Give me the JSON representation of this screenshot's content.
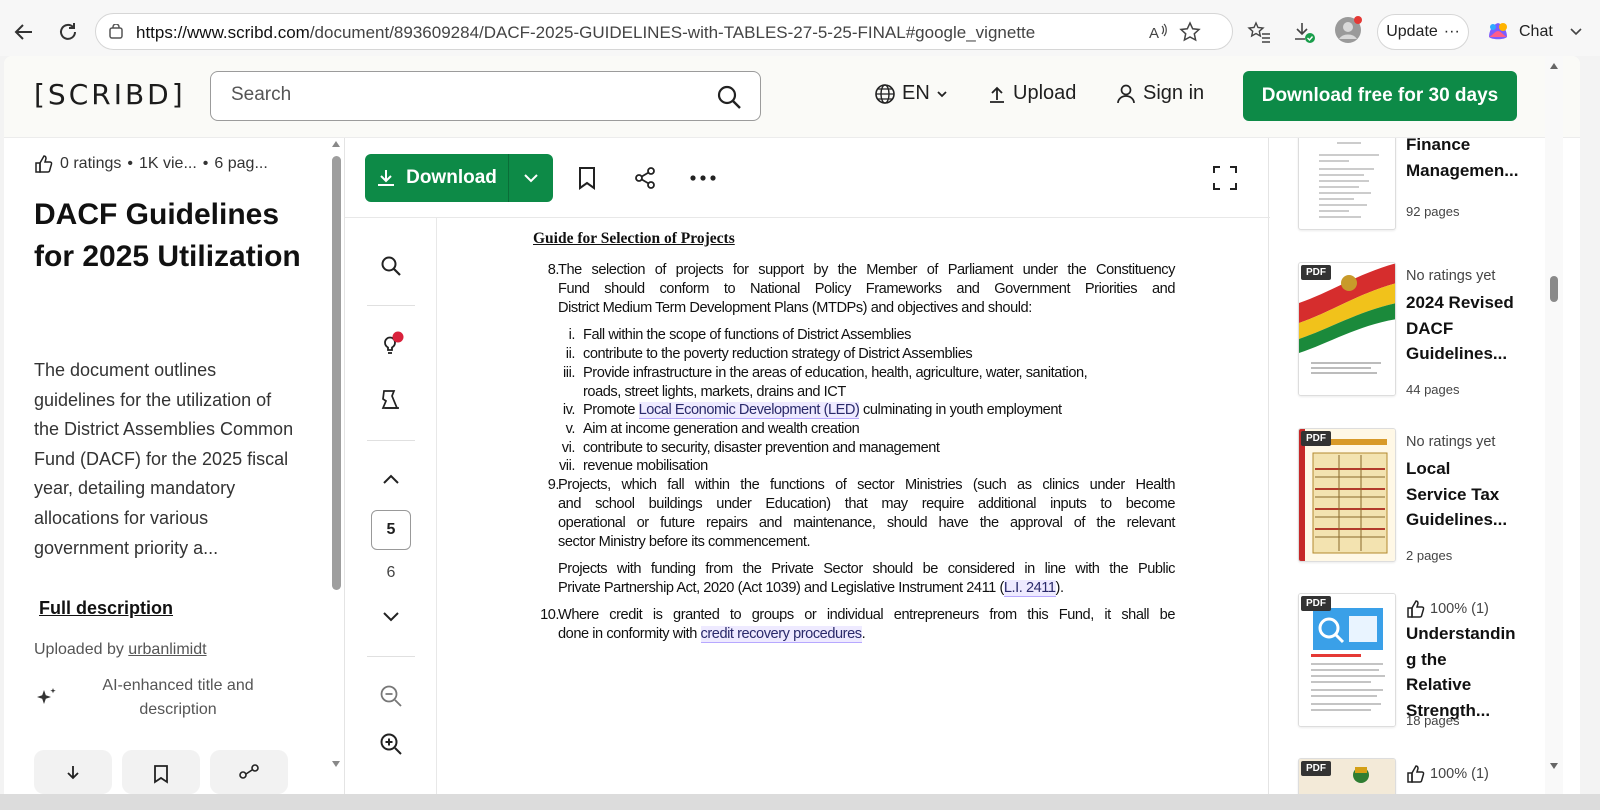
{
  "browser": {
    "url": "https://www.scribd.com/document/893609284/DACF-2025-GUIDELINES-with-TABLES-27-5-25-FINAL#google_vignette",
    "url_host": "https://www.scribd.com",
    "url_path": "/document/893609284/DACF-2025-GUIDELINES-with-TABLES-27-5-25-FINAL#google_vignette",
    "update_label": "Update",
    "update_more": "···",
    "chat_label": "Chat"
  },
  "header": {
    "logo": "[SCRIBD]",
    "search_placeholder": "Search",
    "language": "EN",
    "upload": "Upload",
    "sign_in": "Sign in",
    "cta": "Download free for 30 days",
    "brand_color": "#0d8a47"
  },
  "document": {
    "ratings": "0 ratings",
    "views": "1K vie...",
    "pages": "6 pag...",
    "title": "DACF Guidelines for 2025 Utilization",
    "description": "The document outlines guidelines for the utilization of the District Assemblies Common Fund (DACF) for the 2025 fiscal year, detailing mandatory allocations for various government priority a...",
    "full_description": "Full description",
    "uploaded_prefix": "Uploaded by",
    "uploader": "urbanlimidt",
    "ai_note": "AI-enhanced title and description"
  },
  "viewer": {
    "download": "Download",
    "current_page": "5",
    "next_page": "6"
  },
  "page_content": {
    "heading": "Guide for Selection of Projects",
    "item8_num": "8.",
    "item8_lines": [
      "The selection of projects for support by the Member of Parliament under the Constituency",
      "Fund should conform to National Policy Frameworks and Government Priorities and",
      "District Medium Term Development Plans (MTDPs) and objectives and should:"
    ],
    "roman": [
      {
        "n": "i.",
        "t": "Fall within the scope of functions of District Assemblies"
      },
      {
        "n": "ii.",
        "t": "contribute to the poverty reduction strategy of District Assemblies"
      },
      {
        "n": "iii.",
        "t": "Provide infrastructure in the areas of education, health, agriculture, water, sanitation,"
      },
      {
        "n": "",
        "t": "roads, street lights, markets, drains and ICT"
      },
      {
        "n": "iv.",
        "t": ""
      },
      {
        "n": "v.",
        "t": "Aim at income generation and wealth creation"
      },
      {
        "n": "vi.",
        "t": "contribute to security, disaster prevention and management"
      },
      {
        "n": "vii.",
        "t": "revenue mobilisation"
      }
    ],
    "iv_pre": "Promote ",
    "iv_link": "Local Economic Development (LED)",
    "iv_post": " culminating in youth employment",
    "item9_num": "9.",
    "item9_lines": [
      "Projects, which fall within the functions of sector Ministries (such as clinics under Health",
      "and school buildings under Education) that may require additional inputs to become",
      "operational or future repairs and maintenance, should have the approval of the relevant",
      "sector Ministry before its commencement."
    ],
    "pp_line1": "Projects with funding from the Private Sector should be considered in line with the Public",
    "pp_line2_pre": "Private Partnership Act, 2020 (Act 1039) and Legislative Instrument 2411 (",
    "pp_link": "L.I. 2411",
    "pp_line2_post": ").",
    "item10_num": "10.",
    "item10_line1": "Where credit is granted to groups or individual entrepreneurs from this Fund, it shall be",
    "item10_pre": "done in conformity with ",
    "item10_link": "credit recovery procedures",
    "item10_post": "."
  },
  "recommendations": [
    {
      "meta": "",
      "title": "Finance Managemen...",
      "pages": "92 pages",
      "badge": ""
    },
    {
      "meta": "No ratings yet",
      "title": "2024 Revised DACF Guidelines...",
      "pages": "44 pages",
      "badge": "PDF"
    },
    {
      "meta": "No ratings yet",
      "title": "Local Service Tax Guidelines...",
      "pages": "2 pages",
      "badge": "PDF"
    },
    {
      "meta": "100% (1)",
      "title": "Understandin g the Relative Strength...",
      "pages": "18 pages",
      "badge": "PDF"
    },
    {
      "meta": "100% (1)",
      "title": "",
      "pages": "",
      "badge": "PDF"
    }
  ]
}
